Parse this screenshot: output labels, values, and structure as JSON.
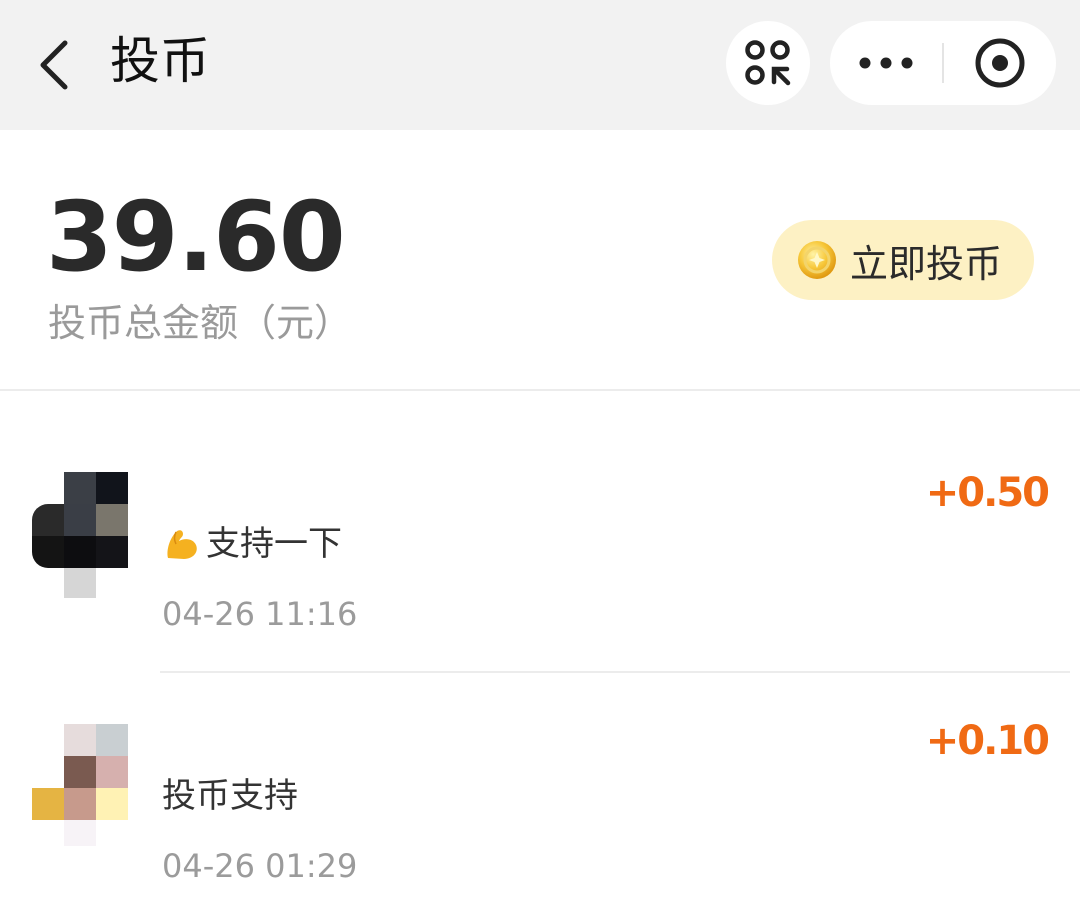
{
  "header": {
    "title": "投币",
    "icons": {
      "back": "chevron-left-icon",
      "scan": "scan-icon",
      "more": "more-icon",
      "close": "target-icon"
    }
  },
  "summary": {
    "total_amount": "39.60",
    "total_label": "投币总金额（元）",
    "action_label": "立即投币",
    "action_icon": "coin-icon",
    "accent_color": "#fdf1c4"
  },
  "records": [
    {
      "message": "支持一下",
      "message_icon": "flexed-biceps-icon",
      "time": "04-26 11:16",
      "amount": "+0.50"
    },
    {
      "message": "投币支持",
      "time": "04-26 01:29",
      "amount": "+0.10"
    }
  ],
  "colors": {
    "amount": "#f06a14",
    "header_bg": "#f2f2f2"
  }
}
